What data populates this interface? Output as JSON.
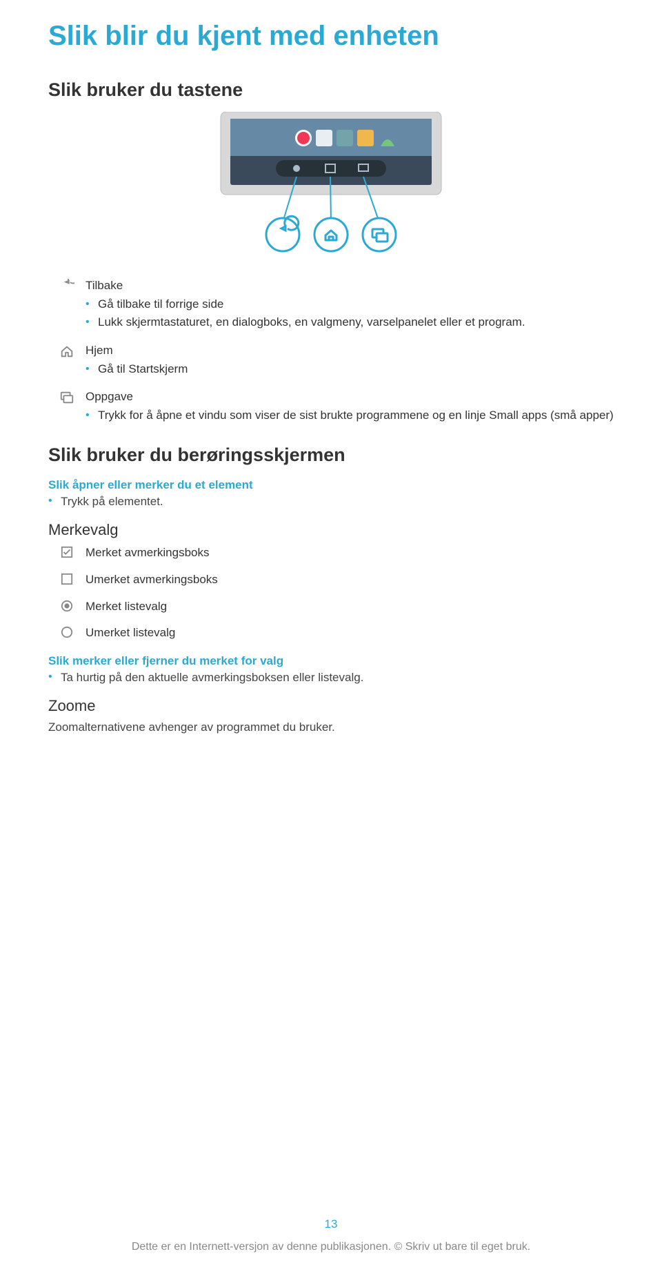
{
  "page_title": "Slik blir du kjent med enheten",
  "section_buttons": "Slik bruker du tastene",
  "items": [
    {
      "label": "Tilbake",
      "bullets": [
        "Gå tilbake til forrige side",
        "Lukk skjermtastaturet, en dialogboks, en valgmeny, varselpanelet eller et program."
      ]
    },
    {
      "label": "Hjem",
      "bullets": [
        "Gå til Startskjerm"
      ]
    },
    {
      "label": "Oppgave",
      "bullets": [
        "Trykk for å åpne et vindu som viser de sist brukte programmene og en linje Small apps (små apper)"
      ]
    }
  ],
  "section_touch": "Slik bruker du berøringsskjermen",
  "touch_sub": "Slik åpner eller merker du et element",
  "touch_line": "Trykk på elementet.",
  "merkevalg": "Merkevalg",
  "merke_items": [
    "Merket avmerkingsboks",
    "Umerket avmerkingsboks",
    "Merket listevalg",
    "Umerket listevalg"
  ],
  "mark_sub": "Slik merker eller fjerner du merket for valg",
  "mark_line": "Ta hurtig på den aktuelle avmerkingsboksen eller listevalg.",
  "zoome": "Zoome",
  "zoome_line": "Zoomalternativene avhenger av programmet du bruker.",
  "page_number": "13",
  "footer_text": "Dette er en Internett-versjon av denne publikasjonen. © Skriv ut bare til eget bruk."
}
